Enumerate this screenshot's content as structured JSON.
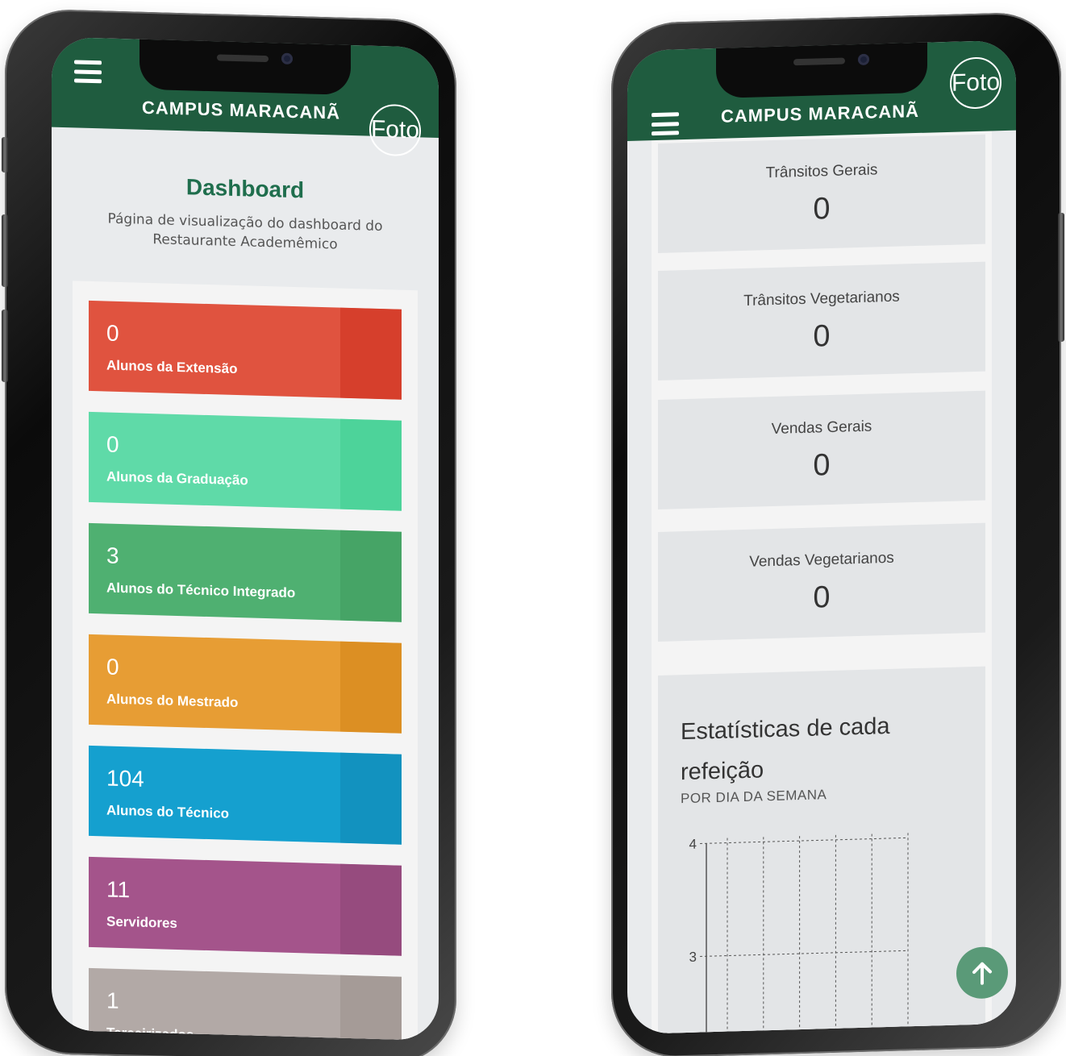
{
  "left_phone": {
    "header": {
      "menu_icon": "hamburger-menu-icon",
      "title": "CAMPUS MARACANÃ",
      "photo_label": "Foto"
    },
    "page": {
      "title": "Dashboard",
      "subtitle": "Página de visualização do dashboard do Restaurante Academêmico"
    },
    "cards": [
      {
        "count": "0",
        "label": "Alunos da Extensão",
        "color": "#e0533f",
        "accent": "#d63f2c"
      },
      {
        "count": "0",
        "label": "Alunos da Graduação",
        "color": "#5fdaa8",
        "accent": "#4dd39a"
      },
      {
        "count": "3",
        "label": "Alunos do Técnico Integrado",
        "color": "#4fb071",
        "accent": "#46a466"
      },
      {
        "count": "0",
        "label": "Alunos do Mestrado",
        "color": "#e79d34",
        "accent": "#dc8f23"
      },
      {
        "count": "104",
        "label": "Alunos do Técnico",
        "color": "#15a0cf",
        "accent": "#1292bf"
      },
      {
        "count": "11",
        "label": "Servidores",
        "color": "#a4548b",
        "accent": "#964b7e"
      },
      {
        "count": "1",
        "label": "Terceirizados",
        "color": "#b2a9a6",
        "accent": "#a59b97"
      }
    ]
  },
  "right_phone": {
    "header": {
      "menu_icon": "hamburger-menu-icon",
      "title": "CAMPUS MARACANÃ",
      "photo_label": "Foto"
    },
    "metrics": [
      {
        "label": "Trânsitos Gerais",
        "value": "0"
      },
      {
        "label": "Trânsitos Vegetarianos",
        "value": "0"
      },
      {
        "label": "Vendas Gerais",
        "value": "0"
      },
      {
        "label": "Vendas Vegetarianos",
        "value": "0"
      }
    ],
    "stats": {
      "title": "Estatísticas de cada refeição",
      "subtitle": "POR DIA DA SEMANA"
    },
    "chart_data": {
      "type": "bar",
      "title": "",
      "xlabel": "",
      "ylabel": "",
      "y_ticks": [
        "4",
        "3"
      ],
      "ylim_visible": [
        3,
        4
      ],
      "grid": true,
      "grid_style": "dashed",
      "vertical_gridlines": 6
    },
    "scroll_top_icon": "arrow-up-icon"
  },
  "colors": {
    "header_green": "#1f5c3f",
    "title_green": "#1f6e4d",
    "fab_green": "#5a9a78"
  }
}
